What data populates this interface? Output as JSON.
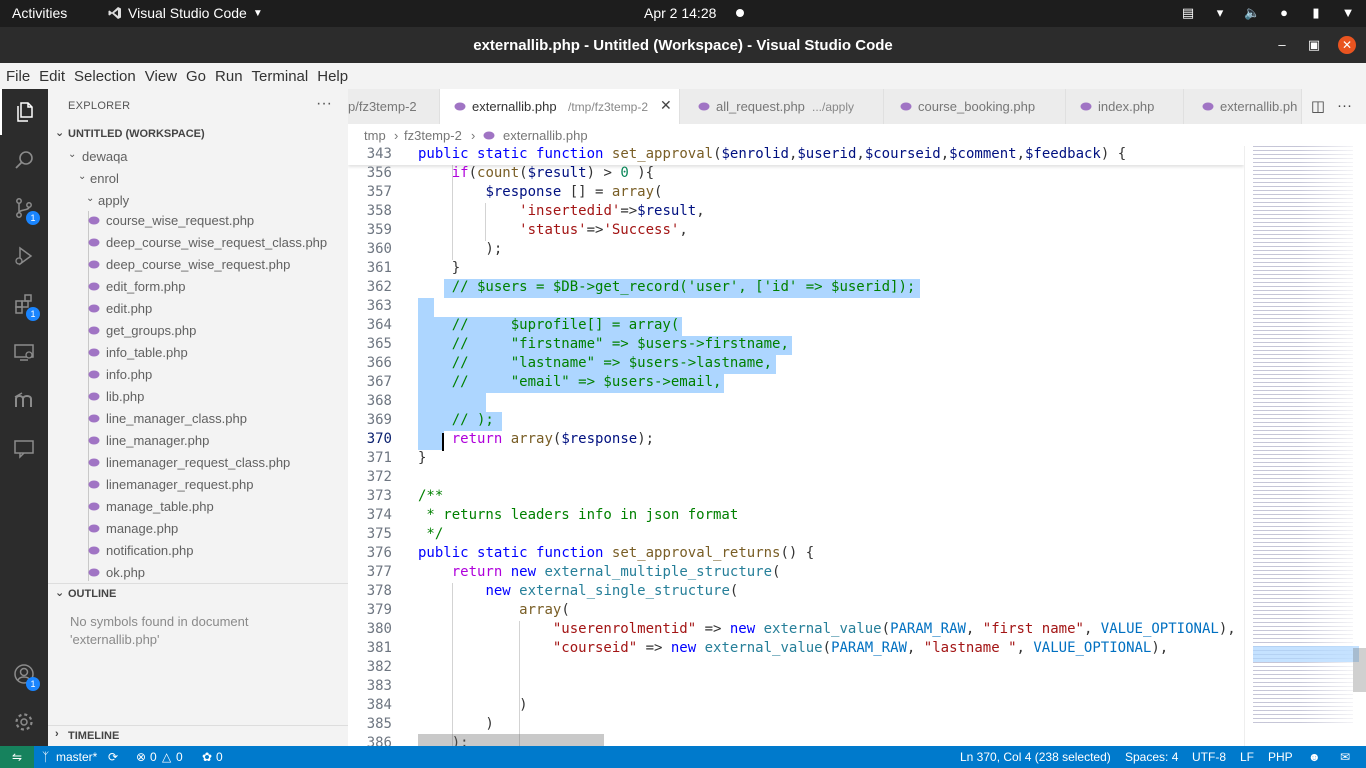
{
  "topbar": {
    "activities": "Activities",
    "app_name": "Visual Studio Code",
    "clock": "Apr 2  14:28"
  },
  "window": {
    "title": "externallib.php - Untitled (Workspace) - Visual Studio Code"
  },
  "menu": [
    "File",
    "Edit",
    "Selection",
    "View",
    "Go",
    "Run",
    "Terminal",
    "Help"
  ],
  "activity_badges": {
    "source_control": "1",
    "extensions": "1",
    "accounts": "1"
  },
  "sidebar": {
    "title": "EXPLORER",
    "more": "···",
    "workspace": "UNTITLED (WORKSPACE)",
    "folders": [
      "dewaqa",
      "enrol",
      "apply"
    ],
    "files": [
      "course_wise_request.php",
      "deep_course_wise_request_class.php",
      "deep_course_wise_request.php",
      "edit_form.php",
      "edit.php",
      "get_groups.php",
      "info_table.php",
      "info.php",
      "lib.php",
      "line_manager_class.php",
      "line_manager.php",
      "linemanager_request_class.php",
      "linemanager_request.php",
      "manage_table.php",
      "manage.php",
      "notification.php",
      "ok.php"
    ],
    "outline_title": "OUTLINE",
    "outline_message": "No symbols found in document 'externallib.php'",
    "timeline_title": "TIMELINE"
  },
  "tabs": [
    {
      "label": "p/fz3temp-2",
      "sub": ""
    },
    {
      "label": "externallib.php",
      "sub": "/tmp/fz3temp-2"
    },
    {
      "label": "all_request.php",
      "sub": ".../apply"
    },
    {
      "label": "course_booking.php",
      "sub": ""
    },
    {
      "label": "index.php",
      "sub": ""
    },
    {
      "label": "externallib.ph",
      "sub": ""
    }
  ],
  "breadcrumb": [
    "tmp",
    "fz3temp-2",
    "externallib.php"
  ],
  "editor": {
    "line_numbers": [
      "343",
      "356",
      "357",
      "358",
      "359",
      "360",
      "361",
      "362",
      "363",
      "364",
      "365",
      "366",
      "367",
      "368",
      "369",
      "370",
      "371",
      "372",
      "373",
      "374",
      "375",
      "376",
      "377",
      "378",
      "379",
      "380",
      "381",
      "382",
      "383",
      "384",
      "385",
      "386"
    ],
    "current_line": "370"
  },
  "status": {
    "branch": "master*",
    "errors": "0",
    "warnings": "0",
    "ports": "0",
    "position": "Ln 370, Col 4 (238 selected)",
    "spaces": "Spaces: 4",
    "encoding": "UTF-8",
    "eol": "LF",
    "language": "PHP"
  },
  "colors": {
    "accent": "#007acc",
    "remote": "#16825d",
    "selection": "#add6ff",
    "badge": "#1a85ff"
  }
}
